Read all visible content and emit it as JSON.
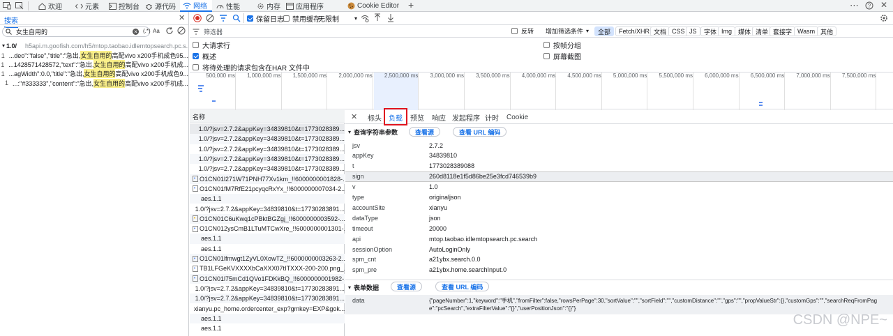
{
  "tabs": [
    {
      "label": "欢迎",
      "icon": "home-icon"
    },
    {
      "label": "元素",
      "icon": "elements-icon"
    },
    {
      "label": "控制台",
      "icon": "console-icon"
    },
    {
      "label": "源代码",
      "icon": "bug-icon"
    },
    {
      "label": "网络",
      "icon": "wifi-icon"
    },
    {
      "label": "性能",
      "icon": "gauge-icon"
    },
    {
      "label": "内存",
      "icon": "gear-icon"
    },
    {
      "label": "应用程序",
      "icon": "app-icon"
    },
    {
      "label": "Cookie Editor",
      "icon": "cookie-icon"
    }
  ],
  "search": {
    "tab_label": "搜索",
    "query": "女生自用的",
    "regex_label": "(.*)",
    "case_label": "Aa",
    "group_toggle": "▾",
    "group_label": "1.0/",
    "group_url": "h5api.m.goofish.com/h5/mtop.taobao.idlemtopsearch.pc.s...",
    "results": [
      {
        "line": "1",
        "pre": "...deo\":\"false\",\"title\":\"急出, ",
        "hl": "女生自用的",
        "post": "高配vivo x200手机成色95..."
      },
      {
        "line": "1",
        "pre": "...1428571428572,\"text\":\"急出, ",
        "hl": "女生自用的",
        "post": "高配vivo x200手机成..."
      },
      {
        "line": "1",
        "pre": "...agWidth\":0.0,\"title\":\"急出, ",
        "hl": "女生自用的",
        "post": "高配vivo x200手机成色9..."
      },
      {
        "line": "1",
        "pre": "...:\"#333333\",\"content\":\"急出, ",
        "hl": "女生自用的",
        "post": "高配vivo x200手机成..."
      }
    ]
  },
  "toolbar": {
    "preserve_log": "保留日志",
    "disable_cache": "禁用缓存",
    "throttle": "无限制",
    "filter_placeholder": "筛选器",
    "invert": "反转",
    "more_filters": "增加筛选条件"
  },
  "type_filters": [
    "全部",
    "Fetch/XHR",
    "文档",
    "CSS",
    "JS",
    "字体",
    "Img",
    "媒体",
    "清单",
    "套接字",
    "Wasm",
    "其他"
  ],
  "options": {
    "big_rows": "大请求行",
    "overview": "概述",
    "include_har": "将待处理的请求包含在HAR 文件中",
    "group_by_frame": "按帧分组",
    "screenshots": "屏幕截图"
  },
  "timeline": [
    "500,000 ms",
    "1,000,000 ms",
    "1,500,000 ms",
    "2,000,000 ms",
    "2,500,000 ms",
    "3,000,000 ms",
    "3,500,000 ms",
    "4,000,000 ms",
    "4,500,000 ms",
    "5,000,000 ms",
    "5,500,000 ms",
    "6,000,000 ms",
    "6,500,000 ms",
    "7,000,000 ms",
    "7,500,000 ms"
  ],
  "requests": {
    "header": "名称",
    "items": [
      {
        "name": "1.0/?jsv=2.7.2&appKey=34839810&t=1773028389...",
        "icon": ""
      },
      {
        "name": "1.0/?jsv=2.7.2&appKey=34839810&t=1773028389...",
        "icon": ""
      },
      {
        "name": "1.0/?jsv=2.7.2&appKey=34839810&t=1773028389...",
        "icon": ""
      },
      {
        "name": "1.0/?jsv=2.7.2&appKey=34839810&t=1773028389...",
        "icon": ""
      },
      {
        "name": "1.0/?jsv=2.7.2&appKey=34839810&t=1773028389...",
        "icon": ""
      },
      {
        "name": "O1CN01l271W71PNH77Xv1km_!!6000000001828-...",
        "icon": "image-file-icon"
      },
      {
        "name": "O1CN01fM7RfE21pcyqcRxYx_!!6000000007034-2...",
        "icon": "image-file-icon"
      },
      {
        "name": "aes.1.1",
        "icon": ""
      },
      {
        "name": "1.0/?jsv=2.7.2&appKey=34839810&t=17730283891...",
        "icon": ""
      },
      {
        "name": "O1CN01C6uKwq1cPBktBGZgj_!!6000000003592-...",
        "icon": "image-file-icon"
      },
      {
        "name": "O1CN012ysCmB1LTuMTCwXre_!!6000000001301-...",
        "icon": "image-file-icon"
      },
      {
        "name": "aes.1.1",
        "icon": ""
      },
      {
        "name": "aes.1.1",
        "icon": ""
      },
      {
        "name": "O1CN01lfmwgt1ZyVL0XowTZ_!!6000000003263-2...",
        "icon": "image-file-icon"
      },
      {
        "name": "TB1LFGeKVXXXXbCaXXX07tITXXX-200-200.png_...",
        "icon": "image-file-icon"
      },
      {
        "name": "O1CN01l75mCd1QVo1FDKkBQ_!!6000000001982-...",
        "icon": "image-file-icon"
      },
      {
        "name": "1.0/?jsv=2.7.2&appKey=34839810&t=17730283891...",
        "icon": ""
      },
      {
        "name": "1.0/?jsv=2.7.2&appKey=34839810&t=17730283891...",
        "icon": ""
      },
      {
        "name": "xianyu.pc_home.ordercenter_exp?gmkey=EXP&gok...",
        "icon": ""
      },
      {
        "name": "aes.1.1",
        "icon": ""
      },
      {
        "name": "aes.1.1",
        "icon": ""
      }
    ]
  },
  "detail": {
    "tabs": [
      "标头",
      "负载",
      "预览",
      "响应",
      "发起程序",
      "计时",
      "Cookie"
    ],
    "query_section": "查询字符串参数",
    "view_source": "查看源",
    "view_url_encoded": "查看 URL 编码",
    "params": [
      {
        "k": "jsv",
        "v": "2.7.2"
      },
      {
        "k": "appKey",
        "v": "34839810"
      },
      {
        "k": "t",
        "v": "1773028389088"
      },
      {
        "k": "sign",
        "v": "260d8118e1f5d86be25e3fcd746539b9"
      },
      {
        "k": "v",
        "v": "1.0"
      },
      {
        "k": "type",
        "v": "originaljson"
      },
      {
        "k": "accountSite",
        "v": "xianyu"
      },
      {
        "k": "dataType",
        "v": "json"
      },
      {
        "k": "timeout",
        "v": "20000"
      },
      {
        "k": "api",
        "v": "mtop.taobao.idlemtopsearch.pc.search"
      },
      {
        "k": "sessionOption",
        "v": "AutoLoginOnly"
      },
      {
        "k": "spm_cnt",
        "v": "a21ybx.search.0.0"
      },
      {
        "k": "spm_pre",
        "v": "a21ybx.home.searchInput.0"
      }
    ],
    "form_section": "表单数据",
    "form_key": "data",
    "form_value_line1": "{\"pageNumber\":1,\"keyword\":\"手机\",\"fromFilter\":false,\"rowsPerPage\":30,\"sortValue\":\"\",\"sortField\":\"\",\"customDistance\":\"\",\"gps\":\"\",\"propValueStr\":{},\"customGps\":\"\",\"searchReqFromPag",
    "form_value_line2": "e\":\"pcSearch\",\"extraFilterValue\":\"{}\",\"userPositionJson\":\"{}\"}"
  },
  "watermark": "CSDN @NPE~",
  "colors": {
    "accent": "#1a73e8",
    "highlight": "#fbf08a",
    "annotation": "#e0141e"
  }
}
